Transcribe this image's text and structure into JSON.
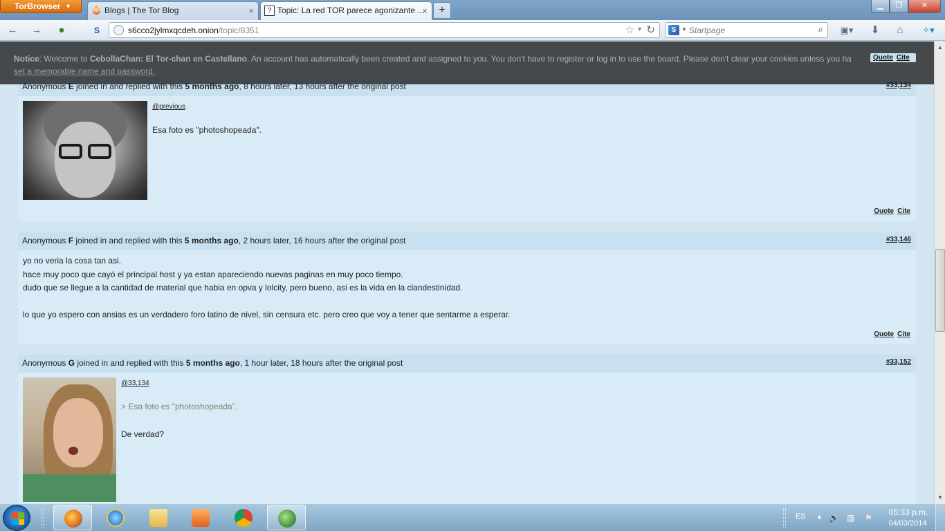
{
  "browser": {
    "menu_label": "TorBrowser",
    "tabs": [
      {
        "title": "Blogs | The Tor Blog",
        "active": false
      },
      {
        "title": "Topic: La red TOR parece agonizante ...",
        "active": true
      }
    ],
    "url_host": "s6cco2jylmxqcdeh.onion",
    "url_path": "/topic/8351",
    "search_placeholder": "Startpage"
  },
  "notice": {
    "text_bold1": "Notice",
    "text1": ": Welcome to ",
    "text_bold2": "CebollaChan: El Tor-chan en Castellano",
    "text2": ". An account has automatically been created and assigned to you. You don't have to register or log in to use the board. Please don't clear your cookies unless you ha",
    "link": "set a memorable name and password",
    "link_tail": ".",
    "quote_label": "Quote",
    "cite_label": "Cite"
  },
  "posts": [
    {
      "author_prefix": "Anonymous ",
      "author_letter": "E",
      "joined": " joined in and replied with this ",
      "age": "5 months ago",
      "timing": ", 8 hours later, 13 hours after the original post",
      "number": "#33,134",
      "mention": "@previous",
      "lines": [
        "Esa foto es \"photoshopeada\"."
      ],
      "quote_label": "Quote",
      "cite_label": "Cite"
    },
    {
      "author_prefix": "Anonymous ",
      "author_letter": "F",
      "joined": " joined in and replied with this ",
      "age": "5 months ago",
      "timing": ", 2 hours later, 16 hours after the original post",
      "number": "#33,146",
      "lines": [
        "yo no veria la cosa tan asi.",
        "hace muy poco que cayó el principal host y ya estan apareciendo nuevas paginas en muy poco tiempo.",
        "dudo que se llegue a la cantidad de material que habia en opva y lolcity, pero bueno, asi es la vida en la clandestinidad.",
        "lo que yo espero con ansias es un verdadero foro latino de nivel, sin censura etc. pero creo que voy a tener que sentarme a esperar."
      ],
      "quote_label": "Quote",
      "cite_label": "Cite"
    },
    {
      "author_prefix": "Anonymous ",
      "author_letter": "G",
      "joined": " joined in and replied with this ",
      "age": "5 months ago",
      "timing": ", 1 hour later, 18 hours after the original post",
      "number": "#33,152",
      "mention": "@33,134",
      "quote_line": "> Esa foto es \"photoshopeada\".",
      "lines": [
        "De verdad?"
      ]
    }
  ],
  "taskbar": {
    "language": "ES",
    "time": "05:33 p.m.",
    "date": "04/03/2014"
  }
}
